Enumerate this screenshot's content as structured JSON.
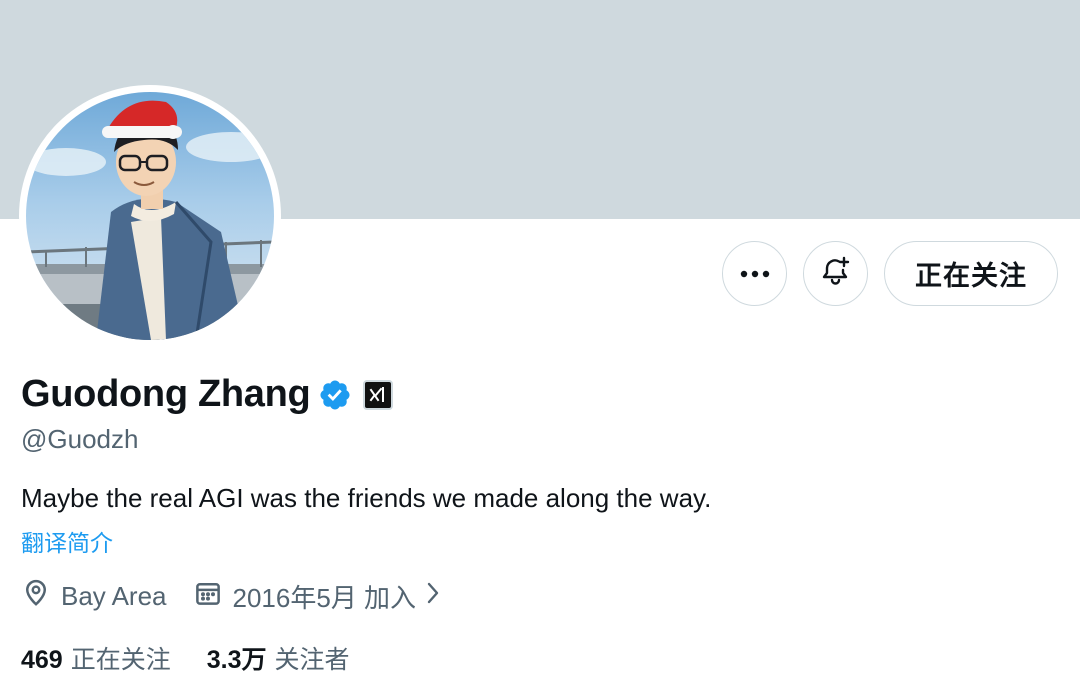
{
  "banner": {
    "color": "#cfd9de"
  },
  "profile": {
    "display_name": "Guodong Zhang",
    "handle": "@Guodzh",
    "bio": "Maybe the real AGI was the friends we made along the way.",
    "translate_link": "翻译简介",
    "location": "Bay Area",
    "join_date": "2016年5月 加入",
    "verified_icon": "verified-badge-icon",
    "affiliation_badge": "xai-logo-icon"
  },
  "actions": {
    "more_icon": "ellipsis-icon",
    "notify_icon": "bell-plus-icon",
    "follow_label": "正在关注"
  },
  "stats": {
    "following_count": "469",
    "following_label": "正在关注",
    "followers_count": "3.3万",
    "followers_label": "关注者"
  },
  "colors": {
    "accent": "#1d9bf0",
    "secondary_text": "#536471",
    "primary_text": "#0f1419",
    "border": "#cfd9de"
  }
}
